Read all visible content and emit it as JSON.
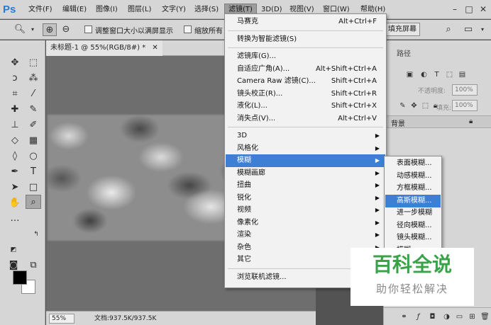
{
  "app": {
    "logo": "Ps"
  },
  "menubar": {
    "items": [
      "文件(F)",
      "编辑(E)",
      "图像(I)",
      "图层(L)",
      "文字(Y)",
      "选择(S)",
      "滤镜(T)",
      "3D(D)",
      "视图(V)",
      "窗口(W)",
      "帮助(H)"
    ],
    "active": "滤镜(T)"
  },
  "window_controls": [
    "minimize-icon",
    "maximize-icon",
    "close-icon"
  ],
  "options_bar": {
    "resize_windows_label": "调整窗口大小以满屏显示",
    "zoom_all_label": "缩放所有",
    "fill_screen_button": "填充屏幕"
  },
  "document": {
    "tab_title": "未标题-1 @ 55%(RGB/8#) *",
    "zoom": "55%",
    "doc_info": "文档:937.5K/937.5K"
  },
  "filter_menu": {
    "items": [
      {
        "label": "马赛克",
        "shortcut": "Alt+Ctrl+F"
      },
      {
        "sep": true
      },
      {
        "label": "转换为智能滤镜(S)",
        "shortcut": ""
      },
      {
        "sep": true
      },
      {
        "label": "滤镜库(G)...",
        "shortcut": ""
      },
      {
        "label": "自适应广角(A)...",
        "shortcut": "Alt+Shift+Ctrl+A"
      },
      {
        "label": "Camera Raw 滤镜(C)...",
        "shortcut": "Shift+Ctrl+A"
      },
      {
        "label": "镜头校正(R)...",
        "shortcut": "Shift+Ctrl+R"
      },
      {
        "label": "液化(L)...",
        "shortcut": "Shift+Ctrl+X"
      },
      {
        "label": "消失点(V)...",
        "shortcut": "Alt+Ctrl+V"
      },
      {
        "sep": true
      },
      {
        "label": "3D",
        "submenu": true
      },
      {
        "label": "风格化",
        "submenu": true
      },
      {
        "label": "模糊",
        "submenu": true,
        "highlighted": true
      },
      {
        "label": "模糊画廊",
        "submenu": true
      },
      {
        "label": "扭曲",
        "submenu": true
      },
      {
        "label": "锐化",
        "submenu": true
      },
      {
        "label": "视频",
        "submenu": true
      },
      {
        "label": "像素化",
        "submenu": true
      },
      {
        "label": "渲染",
        "submenu": true
      },
      {
        "label": "杂色",
        "submenu": true
      },
      {
        "label": "其它",
        "submenu": true
      },
      {
        "sep": true
      },
      {
        "label": "浏览联机滤镜...",
        "shortcut": ""
      }
    ]
  },
  "blur_submenu": {
    "items": [
      {
        "label": "表面模糊..."
      },
      {
        "label": "动感模糊..."
      },
      {
        "label": "方框模糊..."
      },
      {
        "label": "高斯模糊...",
        "highlighted": true
      },
      {
        "label": "进一步模糊"
      },
      {
        "label": "径向模糊..."
      },
      {
        "label": "镜头模糊..."
      },
      {
        "label": "模糊"
      }
    ]
  },
  "right_panel": {
    "tab_label": "路径",
    "opacity_label": "不透明度:",
    "opacity_value": "100%",
    "fill_label": "填充:",
    "fill_value": "100%",
    "layer_name": "背景"
  },
  "watermark": {
    "title": "百科全说",
    "subtitle": "助你轻松解决"
  },
  "colors": {
    "accent": "#3c7fd4",
    "watermark_green": "#3aa34a",
    "foreground": "#000000",
    "background": "#ffffff"
  }
}
